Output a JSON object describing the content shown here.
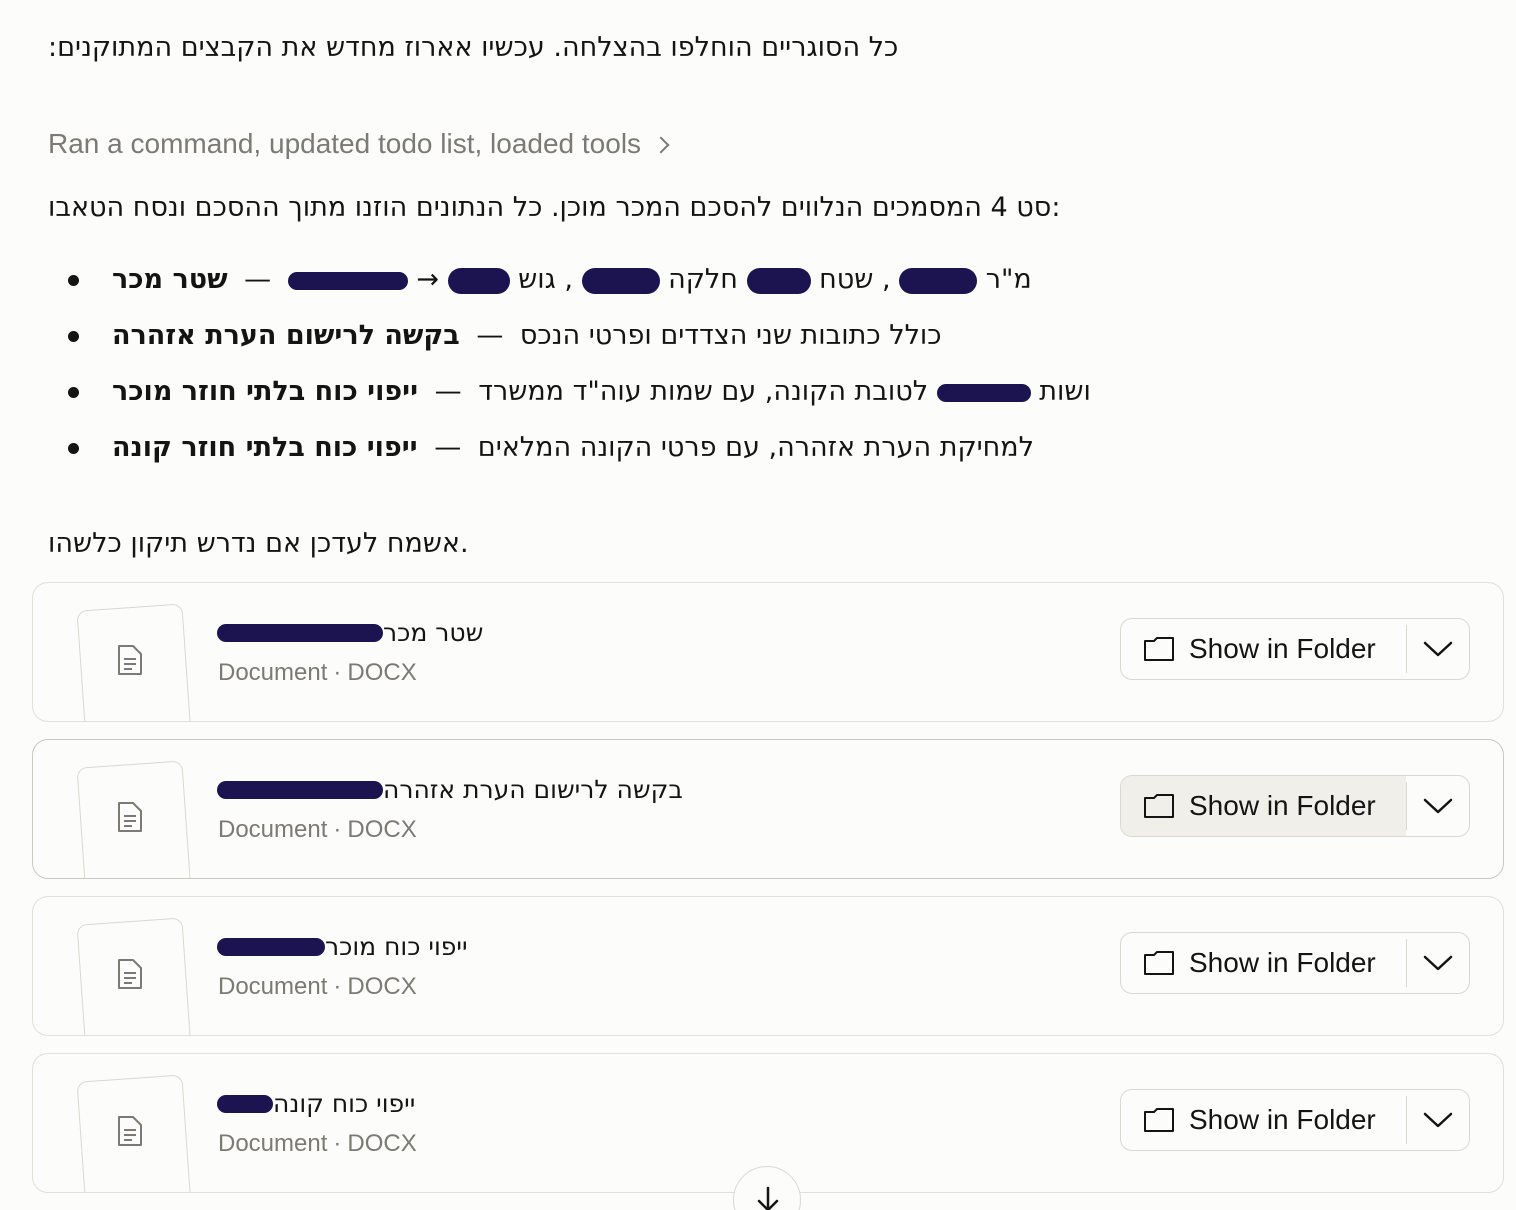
{
  "intro_text": ":כל הסוגריים הוחלפו בהצלחה. עכשיו אארוז מחדש את הקבצים המתוקנים",
  "tools_summary": "Ran a command, updated todo list, loaded tools",
  "summary_text": "סט 4 המסמכים הנלווים להסכם המכר מוכן. כל הנתונים הוזנו מתוך ההסכם ונסח הטאבו:",
  "bullets": [
    {
      "title": "שטר מכר",
      "sep": "—",
      "text_a": "",
      "arrow": "→",
      "text_b": ", גוש",
      "text_c": "חלקה",
      "text_d": ", שטח",
      "text_e": "מ\"ר"
    },
    {
      "title": "בקשה לרישום הערת אזהרה",
      "sep": "—",
      "text": "כולל כתובות שני הצדדים ופרטי הנכס"
    },
    {
      "title": "ייפוי כוח בלתי חוזר מוכר",
      "sep": "—",
      "text_a": "לטובת הקונה, עם שמות עוה\"ד ממשרד",
      "text_b": "ושות"
    },
    {
      "title": "ייפוי כוח בלתי חוזר קונה",
      "sep": "—",
      "text": "למחיקת הערת אזהרה, עם פרטי הקונה המלאים"
    }
  ],
  "closing_text": "אשמח לעדכן אם נדרש תיקון כלשהו.",
  "files": [
    {
      "name": "שטר מכר",
      "type": "Document",
      "format": "DOCX",
      "button": "Show in Folder"
    },
    {
      "name": "בקשה לרישום הערת אזהרה",
      "type": "Document",
      "format": "DOCX",
      "button": "Show in Folder"
    },
    {
      "name": "ייפוי כוח מוכר",
      "type": "Document",
      "format": "DOCX",
      "button": "Show in Folder"
    },
    {
      "name": "ייפוי כוח קונה",
      "type": "Document",
      "format": "DOCX",
      "button": "Show in Folder"
    }
  ],
  "separator_dot": "·",
  "colors": {
    "redaction": "#1c1450",
    "muted_text": "#7b7a74",
    "background": "#fcfcfa"
  },
  "icons": {
    "tools_chevron": "chevron-right-icon",
    "file": "document-icon",
    "folder": "folder-icon",
    "dropdown": "chevron-down-icon",
    "scroll": "arrow-down-icon"
  }
}
